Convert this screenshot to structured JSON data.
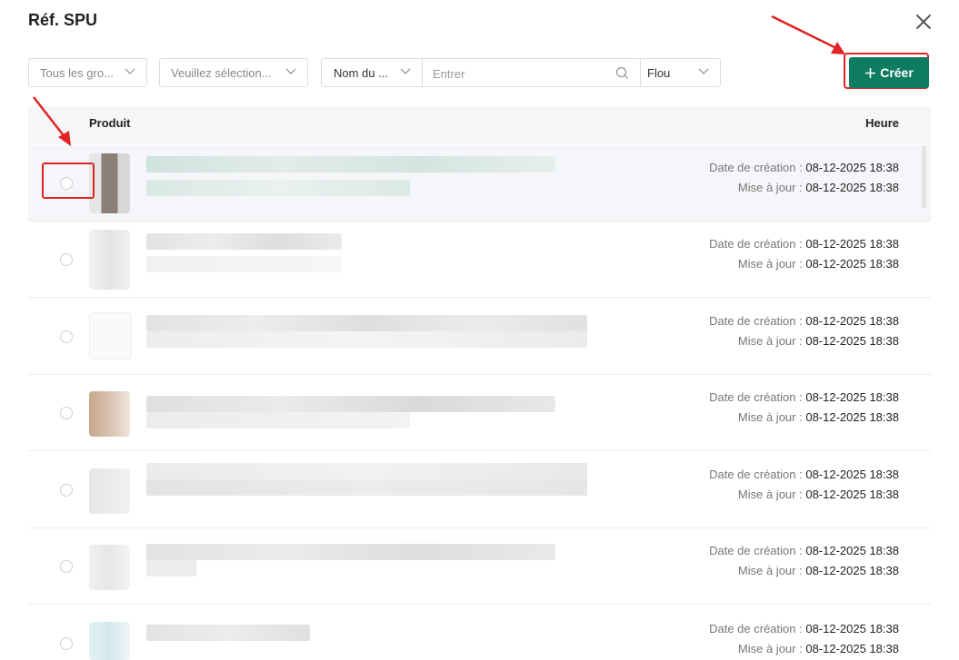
{
  "dialog": {
    "title": "Réf. SPU",
    "close_icon": "close-icon"
  },
  "filters": {
    "group": {
      "label": "Tous les gro..."
    },
    "select": {
      "label": "Veuillez sélection..."
    },
    "field": {
      "label": "Nom du ..."
    },
    "search": {
      "placeholder": "Entrer",
      "icon": "search-icon"
    },
    "mode": {
      "label": "Flou"
    }
  },
  "create_button": {
    "label": "Créer",
    "icon": "plus-icon"
  },
  "table": {
    "headers": {
      "product": "Produit",
      "time": "Heure"
    },
    "rows": [
      {
        "created_label": "Date de création :",
        "created": "08-12-2025 18:38",
        "updated_label": "Mise à jour :",
        "updated": "08-12-2025 18:38"
      },
      {
        "created_label": "Date de création :",
        "created": "08-12-2025 18:38",
        "updated_label": "Mise à jour :",
        "updated": "08-12-2025 18:38"
      },
      {
        "created_label": "Date de création :",
        "created": "08-12-2025 18:38",
        "updated_label": "Mise à jour :",
        "updated": "08-12-2025 18:38"
      },
      {
        "created_label": "Date de création :",
        "created": "08-12-2025 18:38",
        "updated_label": "Mise à jour :",
        "updated": "08-12-2025 18:38"
      },
      {
        "created_label": "Date de création :",
        "created": "08-12-2025 18:38",
        "updated_label": "Mise à jour :",
        "updated": "08-12-2025 18:38"
      },
      {
        "created_label": "Date de création :",
        "created": "08-12-2025 18:38",
        "updated_label": "Mise à jour :",
        "updated": "08-12-2025 18:38"
      },
      {
        "created_label": "Date de création :",
        "created": "08-12-2025 18:38",
        "updated_label": "Mise à jour :",
        "updated": "08-12-2025 18:38"
      }
    ]
  },
  "colors": {
    "accent": "#0e7c60",
    "annotation": "#e12424"
  }
}
